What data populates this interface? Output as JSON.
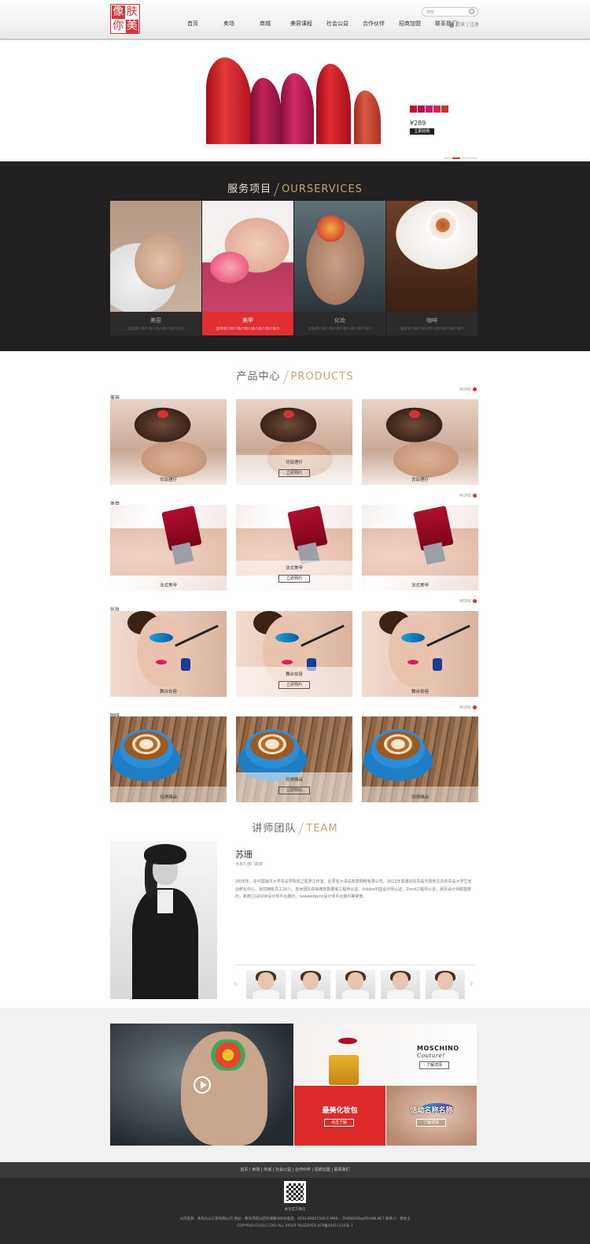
{
  "header": {
    "logo_chars": [
      "像",
      "肤",
      "你",
      "美"
    ],
    "nav": [
      "首页",
      "卖场",
      "商城",
      "美容课程",
      "社会公益",
      "合作伙伴",
      "招商加盟",
      "联系我们"
    ],
    "search_placeholder": "搜索",
    "login": "登录",
    "sep": "|",
    "register": "注册"
  },
  "banner": {
    "swatches": [
      "#c8102e",
      "#b0124a",
      "#c81d6a",
      "#d1284a",
      "#c43a2a"
    ],
    "price": "¥289",
    "buy_label": "立即抢购",
    "lipstick_colors": [
      "#d8232a",
      "#b31545",
      "#c51b5a",
      "#cc1f2d",
      "#c8432e"
    ]
  },
  "services": {
    "title_cn": "服务项目",
    "title_en": "OURSERVICES",
    "items": [
      {
        "title": "美容",
        "desc": "美容简介简介简介简介简介简介简介"
      },
      {
        "title": "美甲",
        "desc": "美甲简介简介简介简介简介简介简介简介"
      },
      {
        "title": "化妆",
        "desc": "化妆简介简介简介简介简介简介简介简介"
      },
      {
        "title": "咖啡",
        "desc": "咖啡简介简介简介简介简介简介简介简介"
      }
    ]
  },
  "products": {
    "title_cn": "产品中心",
    "title_en": "PRODUCTS",
    "more_label": "MORE",
    "book_label": "立即预约",
    "categories": [
      {
        "name": "美容",
        "items": [
          "背部理疗",
          "背部理疗",
          "背部理疗"
        ]
      },
      {
        "name": "美甲",
        "items": [
          "法式美甲",
          "法式美甲",
          "法式美甲"
        ]
      },
      {
        "name": "化妆",
        "items": [
          "舞台妆容",
          "舞台妆容",
          "舞台妆容"
        ]
      },
      {
        "name": "咖啡",
        "items": [
          "玛琪雅朵",
          "玛琪雅朵",
          "玛琪雅朵"
        ]
      }
    ]
  },
  "team": {
    "title_cn": "讲师团队",
    "title_en": "TEAM",
    "name": "苏珊",
    "role": "半永久部门高末",
    "desc": "2006年，在中国海洋大学青岛学院成立凯梦工作室，后更名为青岛凯梦网络有限公司。2013年获邀进驻青岛市政府主办的青岛大学生创业孵化中心，目前拥有员工26人。技术团队获得微软数据库工程师认证、Adobe中国设计师认证、Zend工程师认证，网页设计师联盟簽约，新西兰GDUW设计师平台簽约，newwebpick设计师平台簽约等荣誉。"
  },
  "promo": {
    "brand": "MOSCHINO",
    "brand_script": "Couture!",
    "learn_more": "了解详情",
    "red_title": "最美化妆包",
    "red_button": "点击了解",
    "eye_title": "活动名称名称",
    "eye_button": "了解详情"
  },
  "footer": {
    "nav": [
      "首页",
      "卖场",
      "商城",
      "社会公益",
      "合作伙伴",
      "招商加盟",
      "联系我们"
    ],
    "qr_label": "关注官方微信",
    "company": "公司名称：青岛九山工贸有限公司   地址：青岛市崂山区科海路368号电话：0532-89655508   E-MAIL：ZHENGDD@95HAN.NET   联系人：郭女士",
    "copyright": "COPYRIGHT2015 COGI ALL RIGHT RESERVED |ICP备05011125号-1"
  }
}
